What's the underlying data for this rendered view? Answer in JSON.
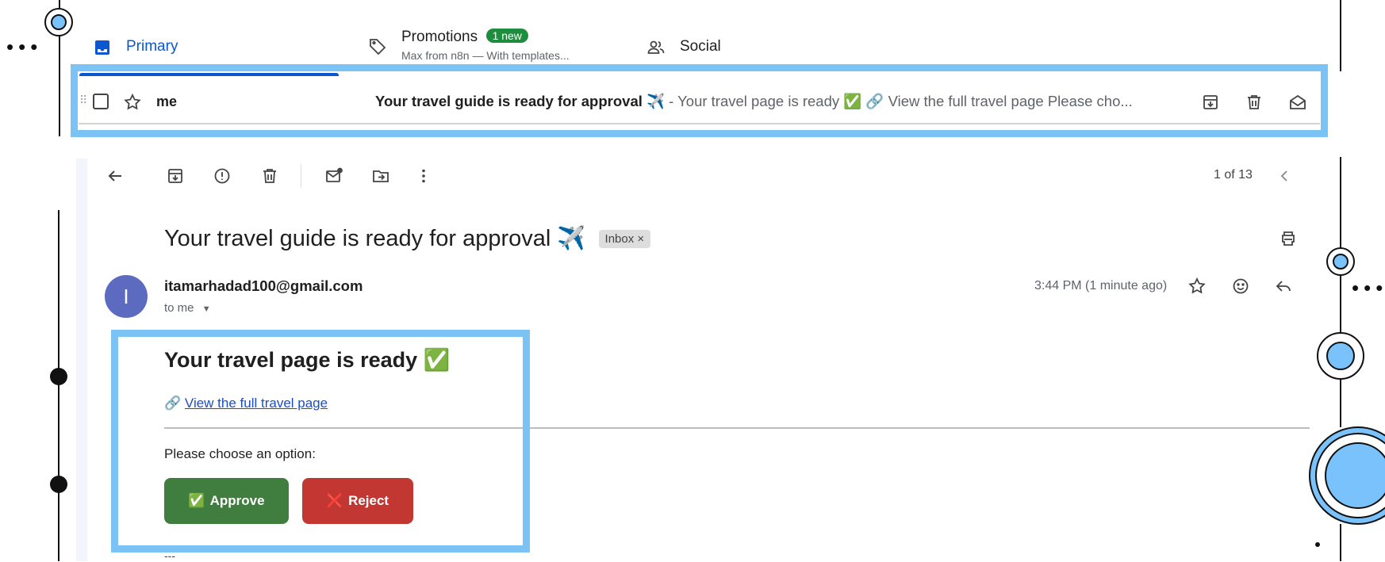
{
  "tabs": {
    "primary": {
      "label": "Primary"
    },
    "promotions": {
      "label": "Promotions",
      "badge": "1 new",
      "preview": "Max from n8n — With templates..."
    },
    "social": {
      "label": "Social"
    }
  },
  "email_row": {
    "sender": "me",
    "subject": "Your travel guide is ready for approval ✈️",
    "snippet": " - Your travel page is ready ✅ 🔗 View the full travel page Please cho..."
  },
  "viewer": {
    "count": "1 of 13",
    "subject": "Your travel guide is ready for approval ✈️",
    "label_chip": "Inbox ×",
    "sender_initial": "I",
    "sender_email": "itamarhadad100@gmail.com",
    "recipient": "to me",
    "time": "3:44 PM (1 minute ago)",
    "body": {
      "title": "Your travel page is ready ✅",
      "link_icon": "🔗",
      "link_text": "View the full travel page",
      "prompt": "Please choose an option:",
      "approve_icon": "✅",
      "approve_label": "Approve",
      "reject_icon": "❌",
      "reject_label": "Reject",
      "signature": "---"
    }
  },
  "colors": {
    "accent": "#0b57d0",
    "highlight": "#7cc3f5",
    "approve": "#3f7e3f",
    "reject": "#c33732",
    "badge": "#1e8e3e"
  },
  "icons": [
    "inbox-icon",
    "tag-icon",
    "people-icon",
    "drag-handle-icon",
    "checkbox-icon",
    "star-icon",
    "archive-icon",
    "trash-icon",
    "mark-unread-icon",
    "back-icon",
    "report-spam-icon",
    "snooze-mail-icon",
    "move-to-icon",
    "more-vert-icon",
    "chevron-left-icon",
    "print-icon",
    "emoji-icon",
    "reply-icon"
  ]
}
